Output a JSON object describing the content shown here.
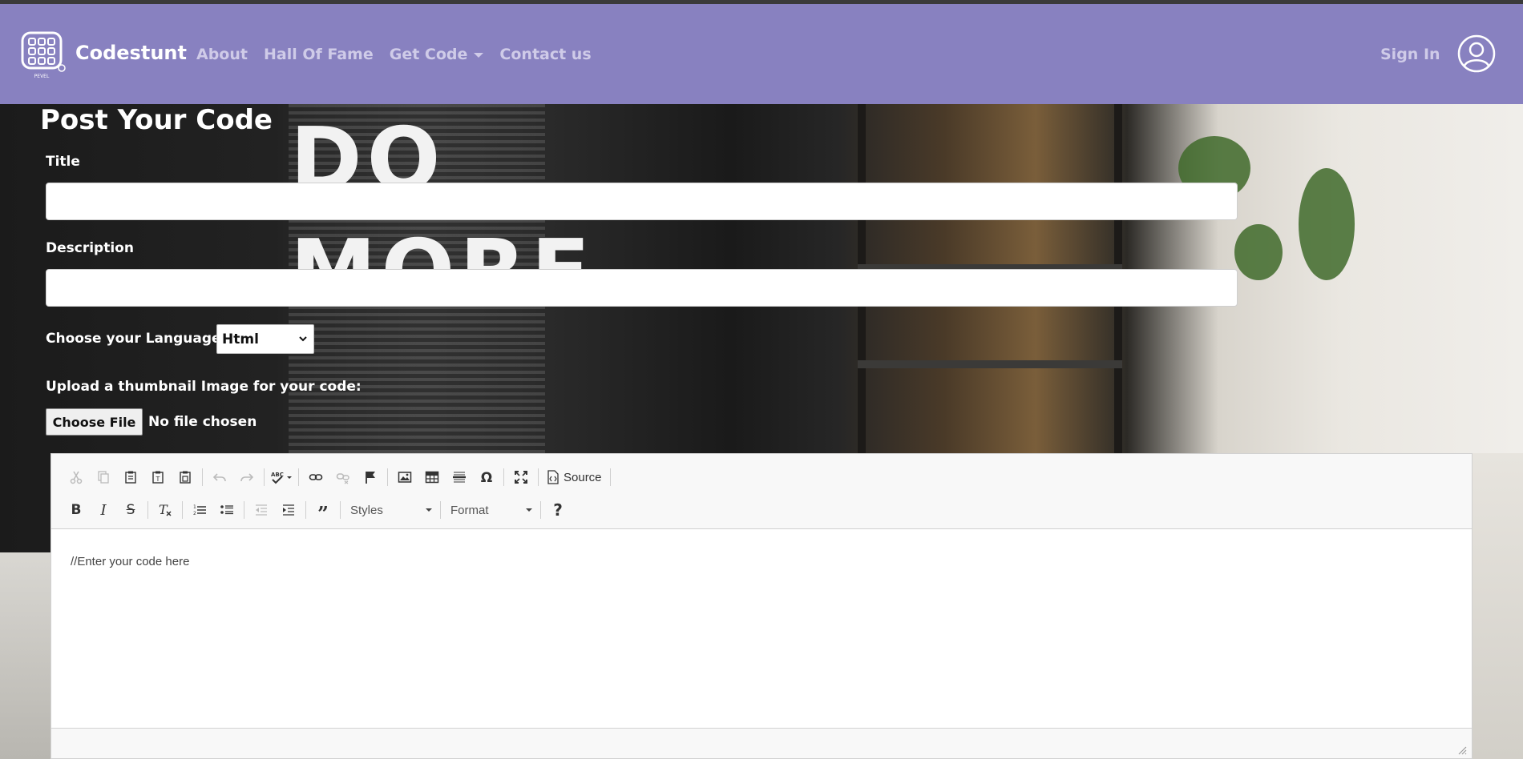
{
  "navbar": {
    "brand_name": "Codestunt",
    "logo_text": "PEVEL",
    "links": [
      {
        "label": "About"
      },
      {
        "label": "Hall Of Fame"
      },
      {
        "label": "Get Code",
        "has_dropdown": true
      },
      {
        "label": "Contact us"
      }
    ],
    "sign_in_label": "Sign In",
    "background_color": "#8881c0"
  },
  "hero": {
    "background_text_line1": "DO",
    "background_text_line2": "MORE"
  },
  "form": {
    "page_title": "Post Your Code",
    "title_label": "Title",
    "title_value": "",
    "description_label": "Description",
    "description_value": "",
    "language_label": "Choose your Language:",
    "language_selected": "Html",
    "upload_label": "Upload a thumbnail Image for your code:",
    "choose_file_label": "Choose File",
    "file_status": "No file chosen"
  },
  "editor": {
    "toolbar_row1": [
      {
        "icon": "cut-icon",
        "disabled": true
      },
      {
        "icon": "copy-icon",
        "disabled": true
      },
      {
        "icon": "paste-icon"
      },
      {
        "icon": "paste-text-icon"
      },
      {
        "icon": "paste-word-icon"
      },
      {
        "icon": "undo-icon",
        "disabled": true
      },
      {
        "icon": "redo-icon",
        "disabled": true
      },
      {
        "icon": "spellcheck-icon"
      },
      {
        "icon": "link-icon"
      },
      {
        "icon": "unlink-icon",
        "disabled": true
      },
      {
        "icon": "anchor-flag-icon"
      },
      {
        "icon": "image-icon"
      },
      {
        "icon": "table-icon"
      },
      {
        "icon": "horizontal-line-icon"
      },
      {
        "icon": "special-char-icon"
      },
      {
        "icon": "maximize-icon"
      }
    ],
    "source_label": "Source",
    "toolbar_row2": [
      {
        "icon": "bold-icon"
      },
      {
        "icon": "italic-icon"
      },
      {
        "icon": "strikethrough-icon"
      },
      {
        "icon": "remove-format-icon"
      },
      {
        "icon": "numbered-list-icon"
      },
      {
        "icon": "bulleted-list-icon"
      },
      {
        "icon": "outdent-icon",
        "disabled": true
      },
      {
        "icon": "indent-icon"
      },
      {
        "icon": "blockquote-icon"
      }
    ],
    "styles_label": "Styles",
    "format_label": "Format",
    "help_label": "?",
    "content": "//Enter your code here"
  }
}
